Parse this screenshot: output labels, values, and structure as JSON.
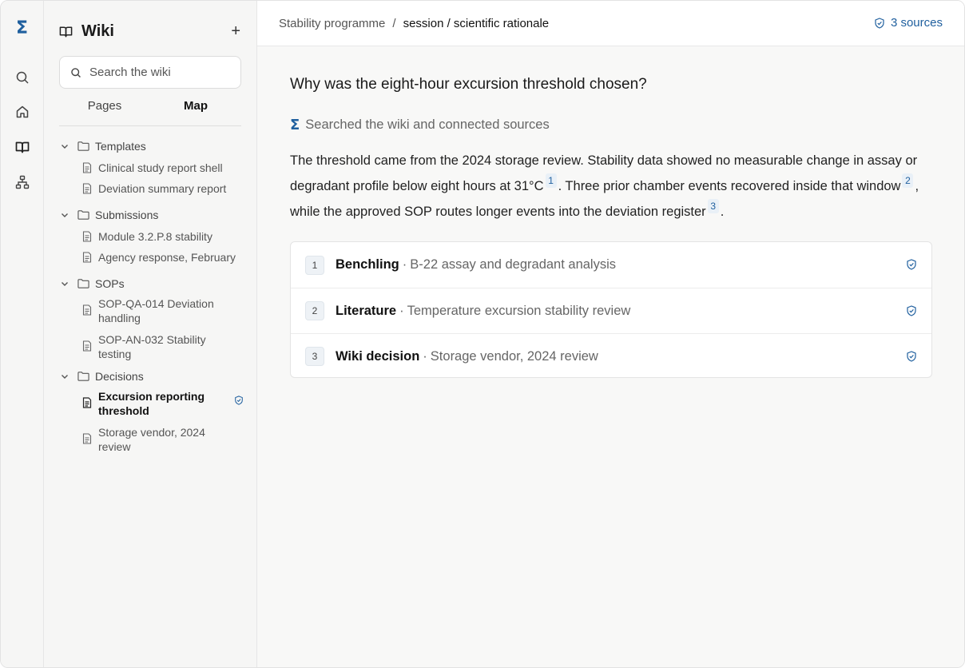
{
  "rail": {
    "logo": "Σ",
    "items": [
      "search",
      "home",
      "wiki",
      "map"
    ]
  },
  "sidebar": {
    "title": "Wiki",
    "add_label": "+",
    "search_placeholder": "Search the wiki",
    "tabs": [
      {
        "label": "Pages",
        "active": false
      },
      {
        "label": "Map",
        "active": true
      }
    ],
    "folders": [
      {
        "label": "Templates",
        "items": [
          "Clinical study report shell",
          "Deviation summary report"
        ]
      },
      {
        "label": "Submissions",
        "items": [
          "Module 3.2.P.8 stability",
          "Agency response, February"
        ]
      },
      {
        "label": "SOPs",
        "items": [
          "SOP-QA-014 Deviation handling",
          "SOP-AN-032 Stability testing"
        ]
      },
      {
        "label": "Decisions",
        "items": [
          "Excursion reporting threshold",
          "Storage vendor, 2024 review"
        ]
      }
    ],
    "active_item": "Excursion reporting threshold"
  },
  "header": {
    "breadcrumb_root": "Stability programme",
    "breadcrumb_sep": "/",
    "breadcrumb_leaf": "session / scientific rationale",
    "sources_label": "3 sources"
  },
  "main": {
    "question": "Why was the eight-hour excursion threshold chosen?",
    "status_icon": "Σ",
    "status_text": "Searched the wiki and connected sources",
    "answer": {
      "part1": "The threshold came from the 2024 storage review. Stability data showed no measurable change in assay or degradant profile below eight hours at 31°C",
      "cite1": "1",
      "part2": ". Three prior chamber events recovered inside that window",
      "cite2": "2",
      "part3": ", while the approved SOP routes longer events into the deviation register",
      "cite3": "3",
      "part4": "."
    },
    "sources": [
      {
        "num": "1",
        "kind": "Benchling",
        "sep": "·",
        "title": "B-22 assay and degradant analysis"
      },
      {
        "num": "2",
        "kind": "Literature",
        "sep": "·",
        "title": "Temperature excursion stability review"
      },
      {
        "num": "3",
        "kind": "Wiki decision",
        "sep": "·",
        "title": "Storage vendor, 2024 review"
      }
    ]
  },
  "colors": {
    "accent": "#1f5f9e",
    "sidebar_bg": "#f6f6f5",
    "main_bg": "#f8f8f7"
  }
}
